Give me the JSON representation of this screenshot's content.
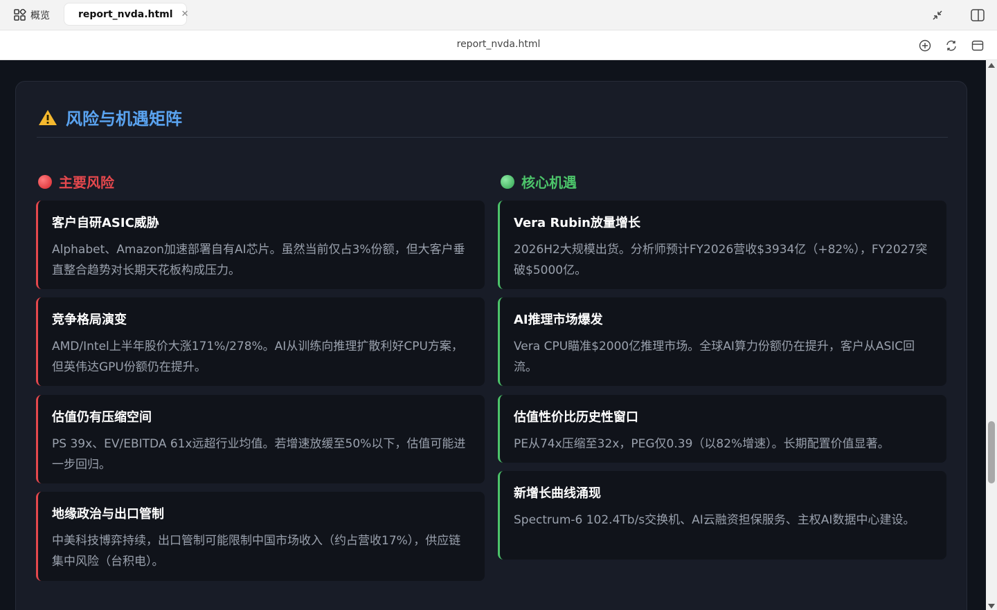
{
  "browser": {
    "overview_label": "概览",
    "tab_title": "report_nvda.html",
    "address": "report_nvda.html"
  },
  "section": {
    "title": "风险与机遇矩阵",
    "risk_heading": "主要风险",
    "opp_heading": "核心机遇"
  },
  "risks": [
    {
      "title": "客户自研ASIC威胁",
      "body": "Alphabet、Amazon加速部署自有AI芯片。虽然当前仅占3%份额，但大客户垂直整合趋势对长期天花板构成压力。"
    },
    {
      "title": "竞争格局演变",
      "body": "AMD/Intel上半年股价大涨171%/278%。AI从训练向推理扩散利好CPU方案，但英伟达GPU份额仍在提升。"
    },
    {
      "title": "估值仍有压缩空间",
      "body": "PS 39x、EV/EBITDA 61x远超行业均值。若增速放缓至50%以下，估值可能进一步回归。"
    },
    {
      "title": "地缘政治与出口管制",
      "body": "中美科技博弈持续，出口管制可能限制中国市场收入（约占营收17%），供应链集中风险（台积电）。"
    }
  ],
  "opportunities": [
    {
      "title": "Vera Rubin放量增长",
      "body": "2026H2大规模出货。分析师预计FY2026营收$3934亿（+82%），FY2027突破$5000亿。"
    },
    {
      "title": "AI推理市场爆发",
      "body": "Vera CPU瞄准$2000亿推理市场。全球AI算力份额仍在提升，客户从ASIC回流。"
    },
    {
      "title": "估值性价比历史性窗口",
      "body": "PE从74x压缩至32x，PEG仅0.39（以82%增速）。长期配置价值显著。"
    },
    {
      "title": "新增长曲线涌现",
      "body": "Spectrum-6 102.4Tb/s交换机、AI云融资担保服务、主权AI数据中心建设。"
    }
  ],
  "colors": {
    "risk": "#e5484d",
    "opportunity": "#4cc46a",
    "title_blue": "#5aa3f0"
  }
}
